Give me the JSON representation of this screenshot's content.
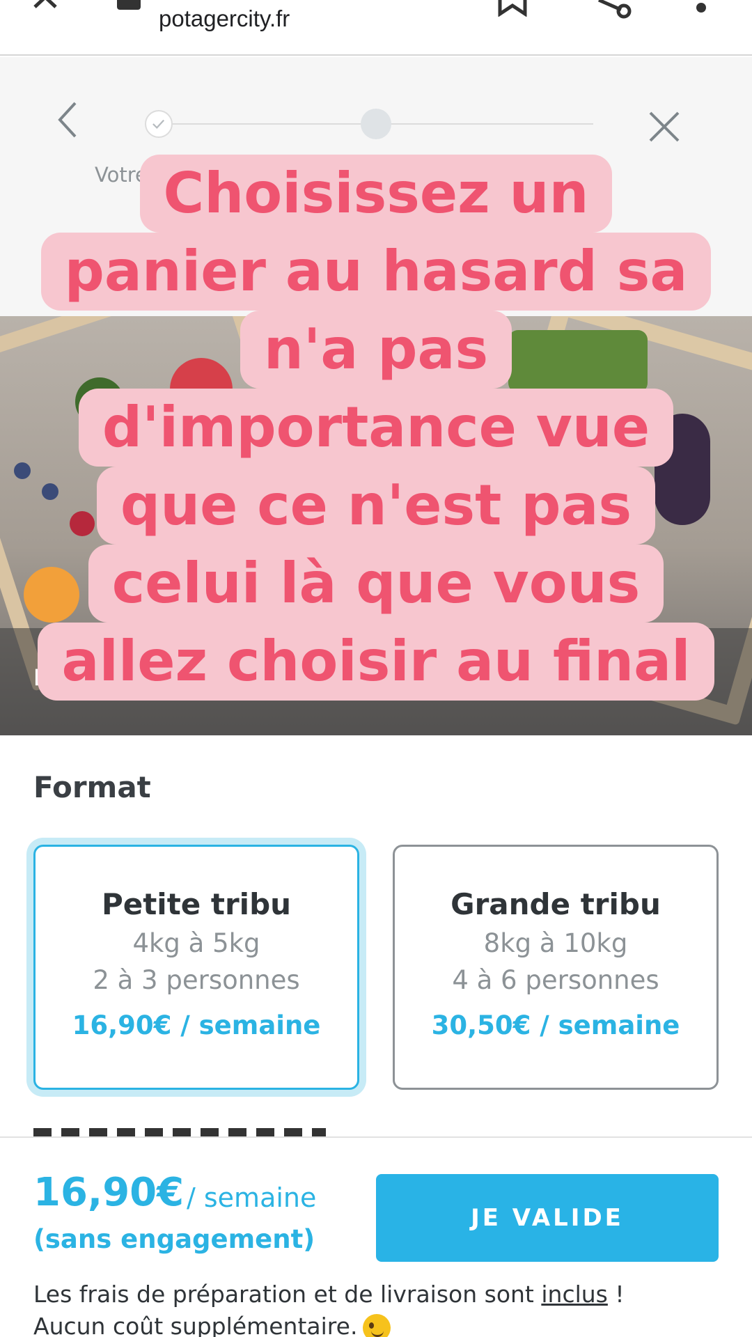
{
  "browser": {
    "url": "potagercity.fr",
    "icons": [
      "close-icon",
      "lock-icon",
      "bookmark-icon",
      "share-icon",
      "more-vert-icon"
    ]
  },
  "stepper": {
    "step_label_partial": "Votre",
    "icons": [
      "chevron-left-icon",
      "check-icon",
      "close-icon"
    ]
  },
  "hero": {
    "caption_partial": "P"
  },
  "overlay": {
    "lines": [
      "Choisissez un",
      "panier au hasard sa",
      "n'a pas",
      "d'importance vue",
      "que ce n'est pas",
      "celui là que vous",
      "allez choisir au final"
    ]
  },
  "format": {
    "title": "Format",
    "options": [
      {
        "name": "Petite tribu",
        "weight": "4kg à 5kg",
        "people": "2 à 3 personnes",
        "price": "16,90€ / semaine",
        "selected": true
      },
      {
        "name": "Grande tribu",
        "weight": "8kg à 10kg",
        "people": "4 à 6 personnes",
        "price": "30,50€ / semaine",
        "selected": false
      }
    ]
  },
  "footer": {
    "price": "16,90€",
    "per": "/ semaine",
    "engagement": "(sans engagement)",
    "button_label": "JE VALIDE",
    "note_part1": "Les frais de préparation et de livraison sont ",
    "note_link": "inclus",
    "note_part2": " !",
    "note_line2": "Aucun coût supplémentaire.",
    "emoji_icon": "winking-face-icon"
  },
  "colors": {
    "accent": "#2bb3e3",
    "overlay_bg": "#f7c6cf",
    "overlay_text": "#ef5470"
  }
}
